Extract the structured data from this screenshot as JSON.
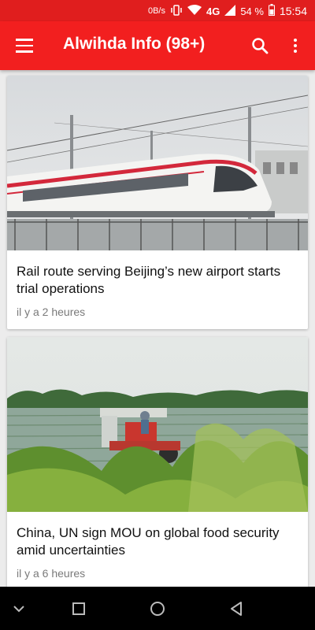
{
  "status_bar": {
    "speed": "0B/s",
    "network": "4G",
    "battery": "54 %",
    "time": "15:54"
  },
  "app_bar": {
    "title": "Alwihda Info (98+)",
    "icons": [
      "menu-icon",
      "search-icon",
      "more-vert-icon"
    ]
  },
  "articles": [
    {
      "headline": "Rail route serving Beijing’s new airport starts trial operations",
      "time": "il y a 2 heures",
      "image": "train-photo"
    },
    {
      "headline": "China, UN sign MOU on global food security amid uncertainties",
      "time": "il y a 6 heures",
      "image": "rice-field-photo"
    }
  ],
  "nav_bar": {
    "icons": [
      "collapse-icon",
      "recents-icon",
      "home-icon",
      "back-icon"
    ]
  },
  "colors": {
    "status_bar": "#e01e1e",
    "app_bar": "#f21f1f",
    "background": "#ececec"
  }
}
